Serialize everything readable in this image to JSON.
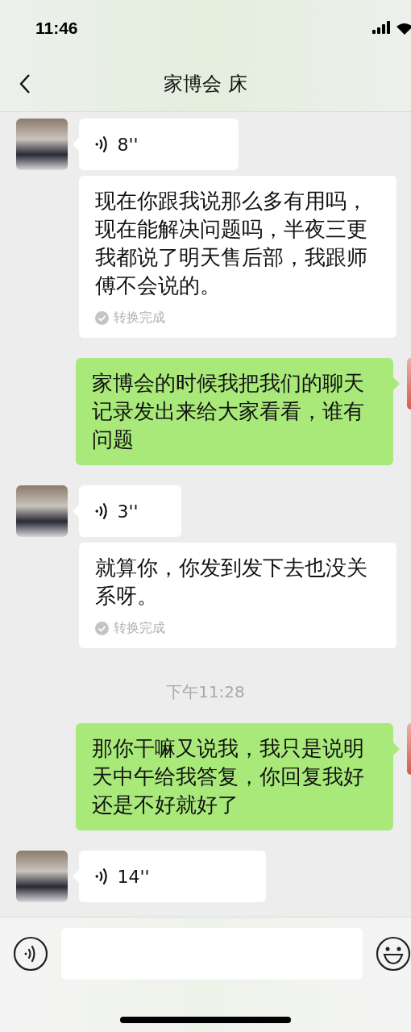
{
  "status_bar": {
    "time": "11:46"
  },
  "header": {
    "title": "家博会 床"
  },
  "messages": [
    {
      "kind": "voice",
      "duration": "8''"
    },
    {
      "kind": "transcript",
      "text": "现在你跟我说那么多有用吗，现在能解决问题吗，半夜三更我都说了明天售后部，我跟师傅不会说的。",
      "status": "转换完成"
    },
    {
      "kind": "outgoing",
      "text": "家博会的时候我把我们的聊天记录发出来给大家看看，谁有问题"
    },
    {
      "kind": "voice",
      "duration": "3''"
    },
    {
      "kind": "transcript",
      "text": "就算你，你发到发下去也没关系呀。",
      "status": "转换完成"
    },
    {
      "kind": "time",
      "text": "下午11:28"
    },
    {
      "kind": "outgoing",
      "text": "那你干嘛又说我，我只是说明天中午给我答复，你回复我好还是不好就好了"
    },
    {
      "kind": "voice",
      "duration": "14''"
    }
  ]
}
